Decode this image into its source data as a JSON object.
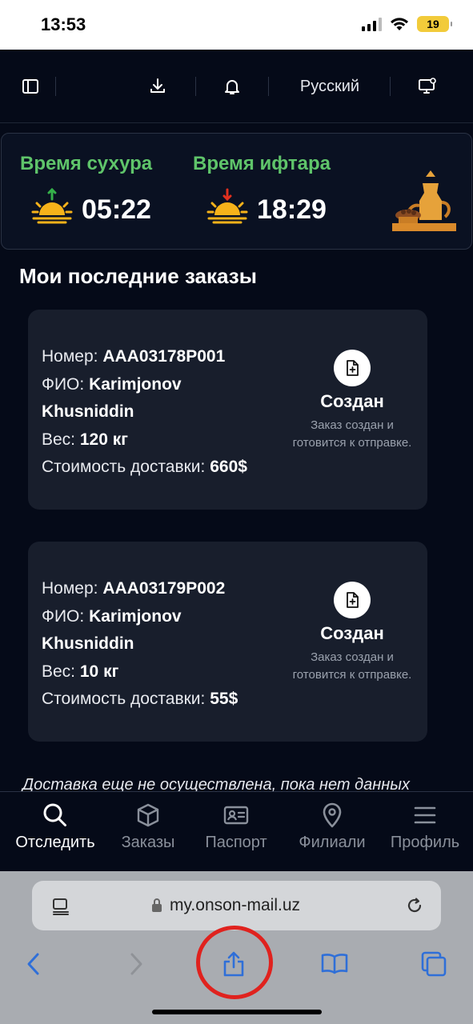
{
  "status": {
    "time": "13:53",
    "battery": "19"
  },
  "topbar": {
    "language": "Русский"
  },
  "ramadan": {
    "suhur_label": "Время сухура",
    "suhur_time": "05:22",
    "iftar_label": "Время ифтара",
    "iftar_time": "18:29"
  },
  "orders_section": {
    "title": "Мои последние заказы"
  },
  "orders": [
    {
      "number_label": "Номер:",
      "number": "AAA03178P001",
      "name_label": "ФИО:",
      "name_line1": "Karimjonov",
      "name_line2": "Khusniddin",
      "weight_label": "Вес:",
      "weight": "120 кг",
      "cost_label": "Стоимость доставки:",
      "cost": "660$",
      "status": "Создан",
      "status_desc": "Заказ создан и готовится к отправке."
    },
    {
      "number_label": "Номер:",
      "number": "AAA03179P002",
      "name_label": "ФИО:",
      "name_line1": "Karimjonov",
      "name_line2": "Khusniddin",
      "weight_label": "Вес:",
      "weight": "10 кг",
      "cost_label": "Стоимость доставки:",
      "cost": "55$",
      "status": "Создан",
      "status_desc": "Заказ создан и готовится к отправке."
    }
  ],
  "delivery_note": "Доставка еще не осуществлена, пока нет данных",
  "nav": [
    {
      "label": "Отследить",
      "icon": "search-icon"
    },
    {
      "label": "Заказы",
      "icon": "box-icon"
    },
    {
      "label": "Паспорт",
      "icon": "id-card-icon"
    },
    {
      "label": "Филиали",
      "icon": "map-pin-icon"
    },
    {
      "label": "Профиль",
      "icon": "menu-icon"
    }
  ],
  "browser": {
    "url": "my.onson-mail.uz"
  },
  "colors": {
    "accent_green": "#5fc46a",
    "background": "#050a18",
    "card": "#181e2c",
    "safari_blue": "#2f6fd8",
    "highlight_ring": "#e0221e"
  }
}
